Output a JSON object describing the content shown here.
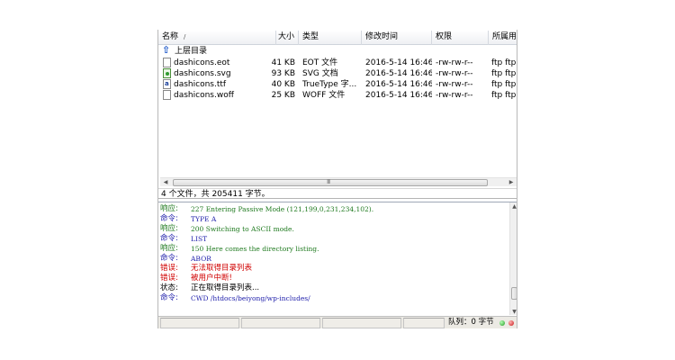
{
  "file_list": {
    "columns": {
      "name": "名称",
      "sort_indicator": "/",
      "size": "大小",
      "type": "类型",
      "modified": "修改时间",
      "perms": "权限",
      "owner": "所属用户"
    },
    "parent_dir": "上层目录",
    "files": [
      {
        "icon": "file-icon",
        "name": "dashicons.eot",
        "size": "41 KB",
        "type": "EOT 文件",
        "modified": "2016-5-14 16:46",
        "perms": "-rw-rw-r--",
        "owner": "ftp ftp"
      },
      {
        "icon": "svg-file-icon",
        "name": "dashicons.svg",
        "size": "93 KB",
        "type": "SVG 文档",
        "modified": "2016-5-14 16:46",
        "perms": "-rw-rw-r--",
        "owner": "ftp ftp"
      },
      {
        "icon": "font-file-icon",
        "name": "dashicons.ttf",
        "size": "40 KB",
        "type": "TrueType 字...",
        "modified": "2016-5-14 16:46",
        "perms": "-rw-rw-r--",
        "owner": "ftp ftp"
      },
      {
        "icon": "file-icon",
        "name": "dashicons.woff",
        "size": "25 KB",
        "type": "WOFF 文件",
        "modified": "2016-5-14 16:46",
        "perms": "-rw-rw-r--",
        "owner": "ftp ftp"
      }
    ],
    "scroll_grip": "III",
    "status": "4 个文件，共 205411 字节。"
  },
  "log": [
    {
      "label": "响应:",
      "kind": "resp",
      "text": "227 Entering Passive Mode (121,199,0,231,234,102)."
    },
    {
      "label": "命令:",
      "kind": "cmd",
      "text": "TYPE A"
    },
    {
      "label": "响应:",
      "kind": "resp",
      "text": "200 Switching to ASCII mode."
    },
    {
      "label": "命令:",
      "kind": "cmd",
      "text": "LIST"
    },
    {
      "label": "响应:",
      "kind": "resp",
      "text": "150 Here comes the directory listing."
    },
    {
      "label": "命令:",
      "kind": "cmd",
      "text": "ABOR"
    },
    {
      "label": "错误:",
      "kind": "err",
      "text": "无法取得目录列表"
    },
    {
      "label": "错误:",
      "kind": "err",
      "text": "被用户中断!"
    },
    {
      "label": "状态:",
      "kind": "stat",
      "text": "正在取得目录列表..."
    },
    {
      "label": "命令:",
      "kind": "cmd",
      "text": "CWD /htdocs/beiyong/wp-includes/"
    }
  ],
  "statusbar": {
    "queue": "队列：0 字节"
  },
  "colors": {
    "response": "#1f7a1f",
    "command": "#1d1daa",
    "error": "#d00000",
    "status": "#000000"
  }
}
